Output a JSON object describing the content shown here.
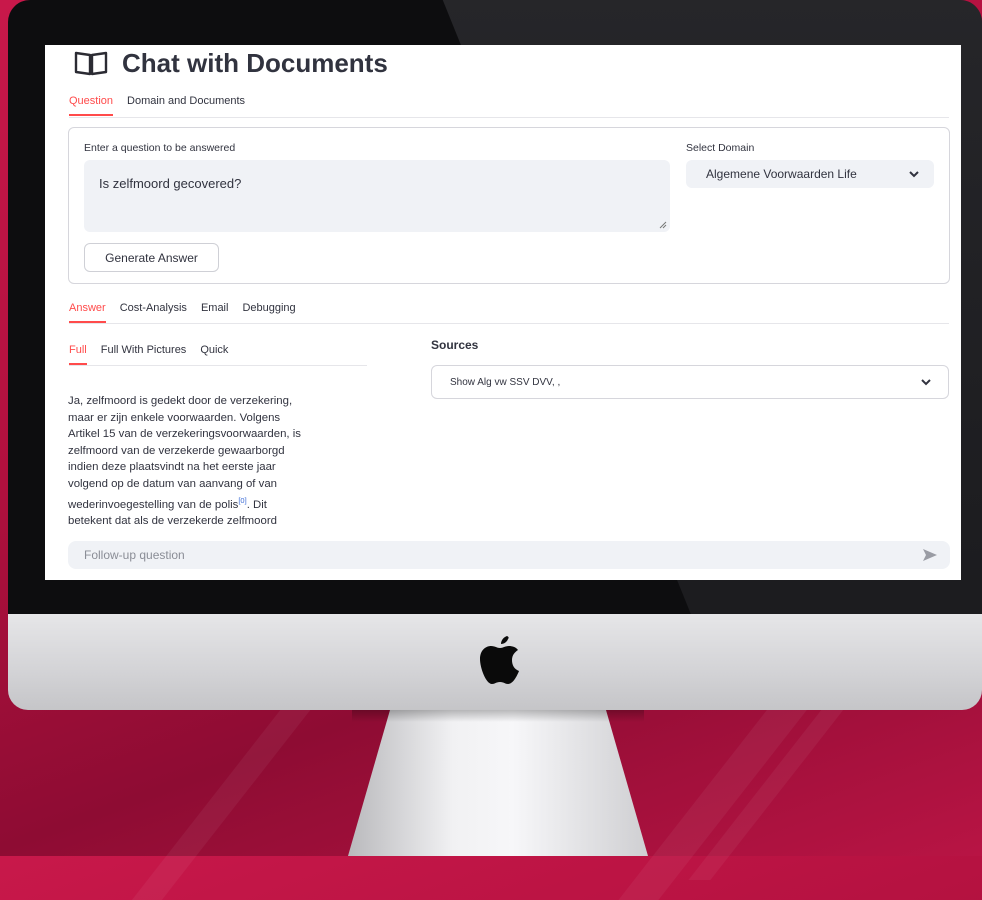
{
  "app": {
    "title": "Chat with Documents"
  },
  "main_tabs": [
    {
      "label": "Question",
      "active": true
    },
    {
      "label": "Domain and Documents",
      "active": false
    }
  ],
  "question_panel": {
    "question_label": "Enter a question to be answered",
    "question_value": "Is zelfmoord gecovered?",
    "generate_button": "Generate Answer",
    "domain_label": "Select Domain",
    "domain_value": "Algemene Voorwaarden Life"
  },
  "result_tabs": [
    {
      "label": "Answer",
      "active": true
    },
    {
      "label": "Cost-Analysis",
      "active": false
    },
    {
      "label": "Email",
      "active": false
    },
    {
      "label": "Debugging",
      "active": false
    }
  ],
  "answer_tabs": [
    {
      "label": "Full",
      "active": true
    },
    {
      "label": "Full With Pictures",
      "active": false
    },
    {
      "label": "Quick",
      "active": false
    }
  ],
  "answer": {
    "text_before_ref": "Ja, zelfmoord is gedekt door de verzekering,\nmaar er zijn enkele voorwaarden. Volgens\nArtikel 15 van de verzekeringsvoorwaarden, is\nzelfmoord van de verzekerde gewaarborgd\nindien deze plaatsvindt na het eerste jaar\nvolgend op de datum van aanvang of van\nwederinvoegestelling van de polis",
    "reference": "[0]",
    "text_after_ref": ". Dit\nbetekent dat als de verzekerde zelfmoord"
  },
  "sources": {
    "title": "Sources",
    "select_value": "Show Alg vw SSV DVV, ,"
  },
  "chat_input": {
    "placeholder": "Follow-up question"
  },
  "icons": {
    "title_icon": "open-book-icon",
    "domain_chevron": "chevron-down-icon",
    "sources_chevron": "chevron-down-icon",
    "send": "send-arrow-icon",
    "brand": "apple-logo-icon"
  },
  "colors": {
    "accent": "#ff4b4b",
    "input_bg": "#f0f2f6",
    "text": "#31333f",
    "background": "#c8184a"
  }
}
